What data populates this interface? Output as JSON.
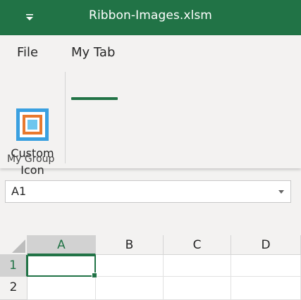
{
  "window": {
    "title": "Ribbon-Images.xlsm",
    "accent_color": "#217346",
    "qat_icon": "customize-qat-dropdown-icon"
  },
  "ribbon": {
    "tabs": [
      {
        "label": "File",
        "selected": false
      },
      {
        "label": "My Tab",
        "selected": true
      }
    ],
    "groups": [
      {
        "label": "My Group",
        "buttons": [
          {
            "label_line1": "Custom",
            "label_line2": "Icon",
            "icon": "custom-concentric-squares-icon"
          }
        ]
      }
    ]
  },
  "namebox": {
    "value": "A1",
    "dropdown_icon": "chevron-down-icon"
  },
  "sheet": {
    "columns": [
      "A",
      "B",
      "C",
      "D"
    ],
    "rows": [
      "1",
      "2"
    ],
    "active_cell": "A1"
  }
}
